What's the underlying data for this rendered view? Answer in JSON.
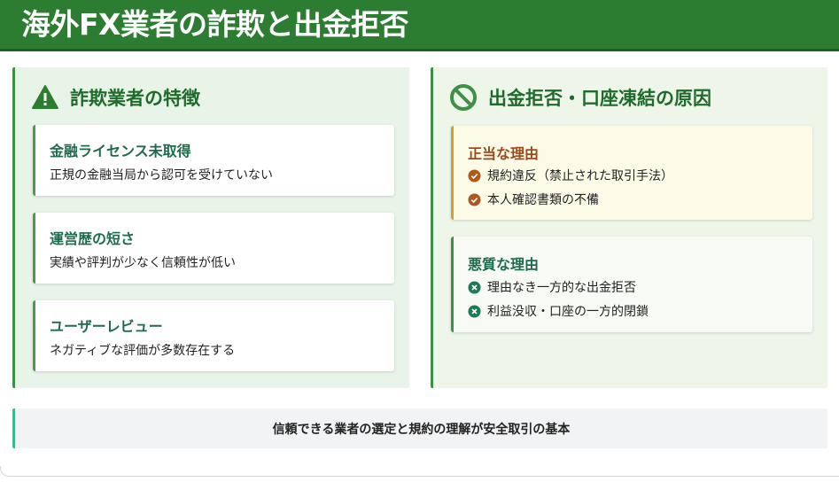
{
  "header": {
    "title": "海外FX業者の詐欺と出金拒否",
    "bg_color": "#2c7d32"
  },
  "left_panel": {
    "title": "詐欺業者の特徴",
    "icon": "warning-triangle-icon",
    "cards": [
      {
        "title": "金融ライセンス未取得",
        "desc": "正規の金融当局から認可を受けていない"
      },
      {
        "title": "運営歴の短さ",
        "desc": "実績や評判が少なく信頼性が低い"
      },
      {
        "title": "ユーザーレビュー",
        "desc": "ネガティブな評価が多数存在する"
      }
    ]
  },
  "right_panel": {
    "title": "出金拒否・口座凍結の原因",
    "icon": "prohibited-icon",
    "legit": {
      "title": "正当な理由",
      "items": [
        "規約違反（禁止された取引手法）",
        "本人確認書類の不備"
      ],
      "accent": "#a0481a"
    },
    "bad": {
      "title": "悪質な理由",
      "items": [
        "理由なき一方的な出金拒否",
        "利益没収・口座の一方的閉鎖"
      ],
      "accent": "#1d6b4a"
    }
  },
  "footer": {
    "text": "信頼できる業者の選定と規約の理解が安全取引の基本"
  }
}
